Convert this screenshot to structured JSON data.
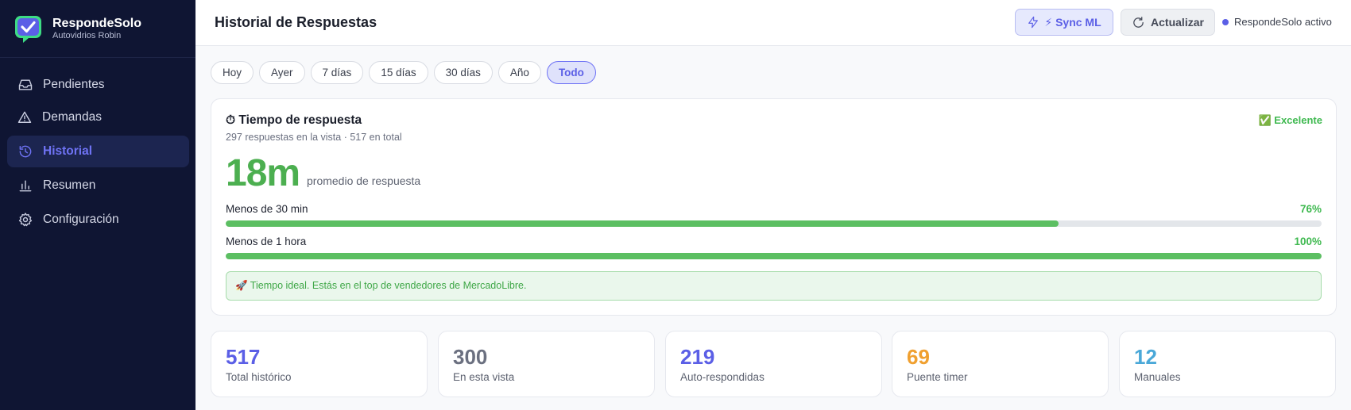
{
  "brand": {
    "name": "RespondeSolo",
    "subtitle": "Autovidrios Robin"
  },
  "sidebar": {
    "items": [
      {
        "label": "Pendientes",
        "icon": "inbox-icon"
      },
      {
        "label": "Demandas",
        "icon": "warning-triangle-icon"
      },
      {
        "label": "Historial",
        "icon": "history-icon",
        "active": true
      },
      {
        "label": "Resumen",
        "icon": "bar-chart-icon"
      },
      {
        "label": "Configuración",
        "icon": "gear-icon"
      }
    ]
  },
  "header": {
    "title": "Historial de Respuestas",
    "sync_label": "⚡ Sync ML",
    "update_label": "Actualizar",
    "status_label": "RespondeSolo activo"
  },
  "filters": [
    "Hoy",
    "Ayer",
    "7 días",
    "15 días",
    "30 días",
    "Año",
    "Todo"
  ],
  "active_filter": "Todo",
  "response_time": {
    "title": "⏱ Tiempo de respuesta",
    "subtitle": "297 respuestas en la vista · 517 en total",
    "badge": "✅ Excelente",
    "average": "18m",
    "average_label": "promedio de respuesta",
    "bars": [
      {
        "label": "Menos de 30 min",
        "value_text": "76%",
        "percent": 76
      },
      {
        "label": "Menos de 1 hora",
        "value_text": "100%",
        "percent": 100
      }
    ],
    "tip": "🚀 Tiempo ideal. Estás en el top de vendedores de MercadoLibre."
  },
  "stats": [
    {
      "value": "517",
      "label": "Total histórico",
      "color": "#5b5fe6"
    },
    {
      "value": "300",
      "label": "En esta vista",
      "color": "#6b7080"
    },
    {
      "value": "219",
      "label": "Auto-respondidas",
      "color": "#5b5fe6"
    },
    {
      "value": "69",
      "label": "Puente timer",
      "color": "#f0a030"
    },
    {
      "value": "12",
      "label": "Manuales",
      "color": "#4aa8d8"
    }
  ]
}
